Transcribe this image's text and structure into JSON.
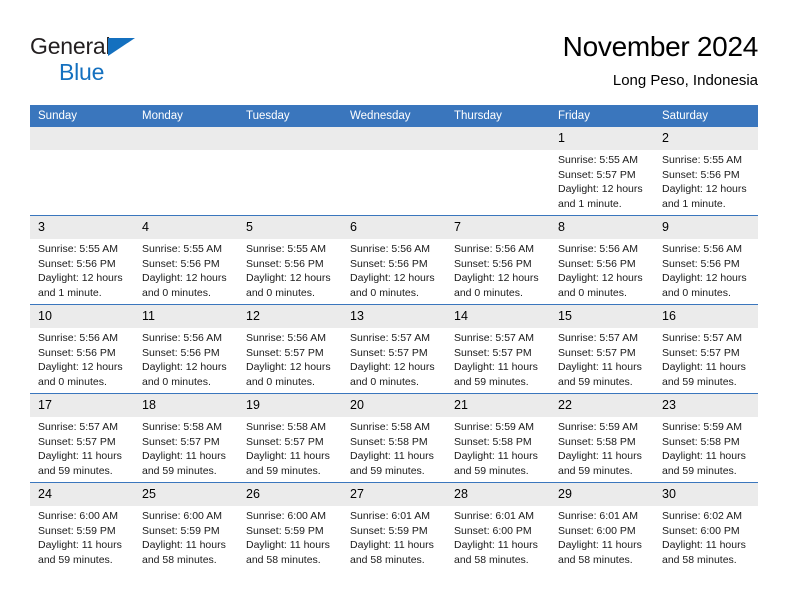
{
  "brand": {
    "name_line1": "General",
    "name_line2": "Blue",
    "triangle_color": "#1470bf"
  },
  "header": {
    "title": "November 2024",
    "subtitle": "Long Peso, Indonesia"
  },
  "colors": {
    "header_blue": "#3a76bd",
    "daynum_band": "#ebebeb",
    "brand_blue": "#1470bf"
  },
  "calendar": {
    "weekday_headers": [
      "Sunday",
      "Monday",
      "Tuesday",
      "Wednesday",
      "Thursday",
      "Friday",
      "Saturday"
    ],
    "weeks": [
      [
        {
          "day": "",
          "empty": true,
          "sunrise": "",
          "sunset": "",
          "daylight1": "",
          "daylight2": ""
        },
        {
          "day": "",
          "empty": true,
          "sunrise": "",
          "sunset": "",
          "daylight1": "",
          "daylight2": ""
        },
        {
          "day": "",
          "empty": true,
          "sunrise": "",
          "sunset": "",
          "daylight1": "",
          "daylight2": ""
        },
        {
          "day": "",
          "empty": true,
          "sunrise": "",
          "sunset": "",
          "daylight1": "",
          "daylight2": ""
        },
        {
          "day": "",
          "empty": true,
          "sunrise": "",
          "sunset": "",
          "daylight1": "",
          "daylight2": ""
        },
        {
          "day": "1",
          "empty": false,
          "sunrise": "Sunrise: 5:55 AM",
          "sunset": "Sunset: 5:57 PM",
          "daylight1": "Daylight: 12 hours",
          "daylight2": "and 1 minute."
        },
        {
          "day": "2",
          "empty": false,
          "sunrise": "Sunrise: 5:55 AM",
          "sunset": "Sunset: 5:56 PM",
          "daylight1": "Daylight: 12 hours",
          "daylight2": "and 1 minute."
        }
      ],
      [
        {
          "day": "3",
          "empty": false,
          "sunrise": "Sunrise: 5:55 AM",
          "sunset": "Sunset: 5:56 PM",
          "daylight1": "Daylight: 12 hours",
          "daylight2": "and 1 minute."
        },
        {
          "day": "4",
          "empty": false,
          "sunrise": "Sunrise: 5:55 AM",
          "sunset": "Sunset: 5:56 PM",
          "daylight1": "Daylight: 12 hours",
          "daylight2": "and 0 minutes."
        },
        {
          "day": "5",
          "empty": false,
          "sunrise": "Sunrise: 5:55 AM",
          "sunset": "Sunset: 5:56 PM",
          "daylight1": "Daylight: 12 hours",
          "daylight2": "and 0 minutes."
        },
        {
          "day": "6",
          "empty": false,
          "sunrise": "Sunrise: 5:56 AM",
          "sunset": "Sunset: 5:56 PM",
          "daylight1": "Daylight: 12 hours",
          "daylight2": "and 0 minutes."
        },
        {
          "day": "7",
          "empty": false,
          "sunrise": "Sunrise: 5:56 AM",
          "sunset": "Sunset: 5:56 PM",
          "daylight1": "Daylight: 12 hours",
          "daylight2": "and 0 minutes."
        },
        {
          "day": "8",
          "empty": false,
          "sunrise": "Sunrise: 5:56 AM",
          "sunset": "Sunset: 5:56 PM",
          "daylight1": "Daylight: 12 hours",
          "daylight2": "and 0 minutes."
        },
        {
          "day": "9",
          "empty": false,
          "sunrise": "Sunrise: 5:56 AM",
          "sunset": "Sunset: 5:56 PM",
          "daylight1": "Daylight: 12 hours",
          "daylight2": "and 0 minutes."
        }
      ],
      [
        {
          "day": "10",
          "empty": false,
          "sunrise": "Sunrise: 5:56 AM",
          "sunset": "Sunset: 5:56 PM",
          "daylight1": "Daylight: 12 hours",
          "daylight2": "and 0 minutes."
        },
        {
          "day": "11",
          "empty": false,
          "sunrise": "Sunrise: 5:56 AM",
          "sunset": "Sunset: 5:56 PM",
          "daylight1": "Daylight: 12 hours",
          "daylight2": "and 0 minutes."
        },
        {
          "day": "12",
          "empty": false,
          "sunrise": "Sunrise: 5:56 AM",
          "sunset": "Sunset: 5:57 PM",
          "daylight1": "Daylight: 12 hours",
          "daylight2": "and 0 minutes."
        },
        {
          "day": "13",
          "empty": false,
          "sunrise": "Sunrise: 5:57 AM",
          "sunset": "Sunset: 5:57 PM",
          "daylight1": "Daylight: 12 hours",
          "daylight2": "and 0 minutes."
        },
        {
          "day": "14",
          "empty": false,
          "sunrise": "Sunrise: 5:57 AM",
          "sunset": "Sunset: 5:57 PM",
          "daylight1": "Daylight: 11 hours",
          "daylight2": "and 59 minutes."
        },
        {
          "day": "15",
          "empty": false,
          "sunrise": "Sunrise: 5:57 AM",
          "sunset": "Sunset: 5:57 PM",
          "daylight1": "Daylight: 11 hours",
          "daylight2": "and 59 minutes."
        },
        {
          "day": "16",
          "empty": false,
          "sunrise": "Sunrise: 5:57 AM",
          "sunset": "Sunset: 5:57 PM",
          "daylight1": "Daylight: 11 hours",
          "daylight2": "and 59 minutes."
        }
      ],
      [
        {
          "day": "17",
          "empty": false,
          "sunrise": "Sunrise: 5:57 AM",
          "sunset": "Sunset: 5:57 PM",
          "daylight1": "Daylight: 11 hours",
          "daylight2": "and 59 minutes."
        },
        {
          "day": "18",
          "empty": false,
          "sunrise": "Sunrise: 5:58 AM",
          "sunset": "Sunset: 5:57 PM",
          "daylight1": "Daylight: 11 hours",
          "daylight2": "and 59 minutes."
        },
        {
          "day": "19",
          "empty": false,
          "sunrise": "Sunrise: 5:58 AM",
          "sunset": "Sunset: 5:57 PM",
          "daylight1": "Daylight: 11 hours",
          "daylight2": "and 59 minutes."
        },
        {
          "day": "20",
          "empty": false,
          "sunrise": "Sunrise: 5:58 AM",
          "sunset": "Sunset: 5:58 PM",
          "daylight1": "Daylight: 11 hours",
          "daylight2": "and 59 minutes."
        },
        {
          "day": "21",
          "empty": false,
          "sunrise": "Sunrise: 5:59 AM",
          "sunset": "Sunset: 5:58 PM",
          "daylight1": "Daylight: 11 hours",
          "daylight2": "and 59 minutes."
        },
        {
          "day": "22",
          "empty": false,
          "sunrise": "Sunrise: 5:59 AM",
          "sunset": "Sunset: 5:58 PM",
          "daylight1": "Daylight: 11 hours",
          "daylight2": "and 59 minutes."
        },
        {
          "day": "23",
          "empty": false,
          "sunrise": "Sunrise: 5:59 AM",
          "sunset": "Sunset: 5:58 PM",
          "daylight1": "Daylight: 11 hours",
          "daylight2": "and 59 minutes."
        }
      ],
      [
        {
          "day": "24",
          "empty": false,
          "sunrise": "Sunrise: 6:00 AM",
          "sunset": "Sunset: 5:59 PM",
          "daylight1": "Daylight: 11 hours",
          "daylight2": "and 59 minutes."
        },
        {
          "day": "25",
          "empty": false,
          "sunrise": "Sunrise: 6:00 AM",
          "sunset": "Sunset: 5:59 PM",
          "daylight1": "Daylight: 11 hours",
          "daylight2": "and 58 minutes."
        },
        {
          "day": "26",
          "empty": false,
          "sunrise": "Sunrise: 6:00 AM",
          "sunset": "Sunset: 5:59 PM",
          "daylight1": "Daylight: 11 hours",
          "daylight2": "and 58 minutes."
        },
        {
          "day": "27",
          "empty": false,
          "sunrise": "Sunrise: 6:01 AM",
          "sunset": "Sunset: 5:59 PM",
          "daylight1": "Daylight: 11 hours",
          "daylight2": "and 58 minutes."
        },
        {
          "day": "28",
          "empty": false,
          "sunrise": "Sunrise: 6:01 AM",
          "sunset": "Sunset: 6:00 PM",
          "daylight1": "Daylight: 11 hours",
          "daylight2": "and 58 minutes."
        },
        {
          "day": "29",
          "empty": false,
          "sunrise": "Sunrise: 6:01 AM",
          "sunset": "Sunset: 6:00 PM",
          "daylight1": "Daylight: 11 hours",
          "daylight2": "and 58 minutes."
        },
        {
          "day": "30",
          "empty": false,
          "sunrise": "Sunrise: 6:02 AM",
          "sunset": "Sunset: 6:00 PM",
          "daylight1": "Daylight: 11 hours",
          "daylight2": "and 58 minutes."
        }
      ]
    ]
  }
}
